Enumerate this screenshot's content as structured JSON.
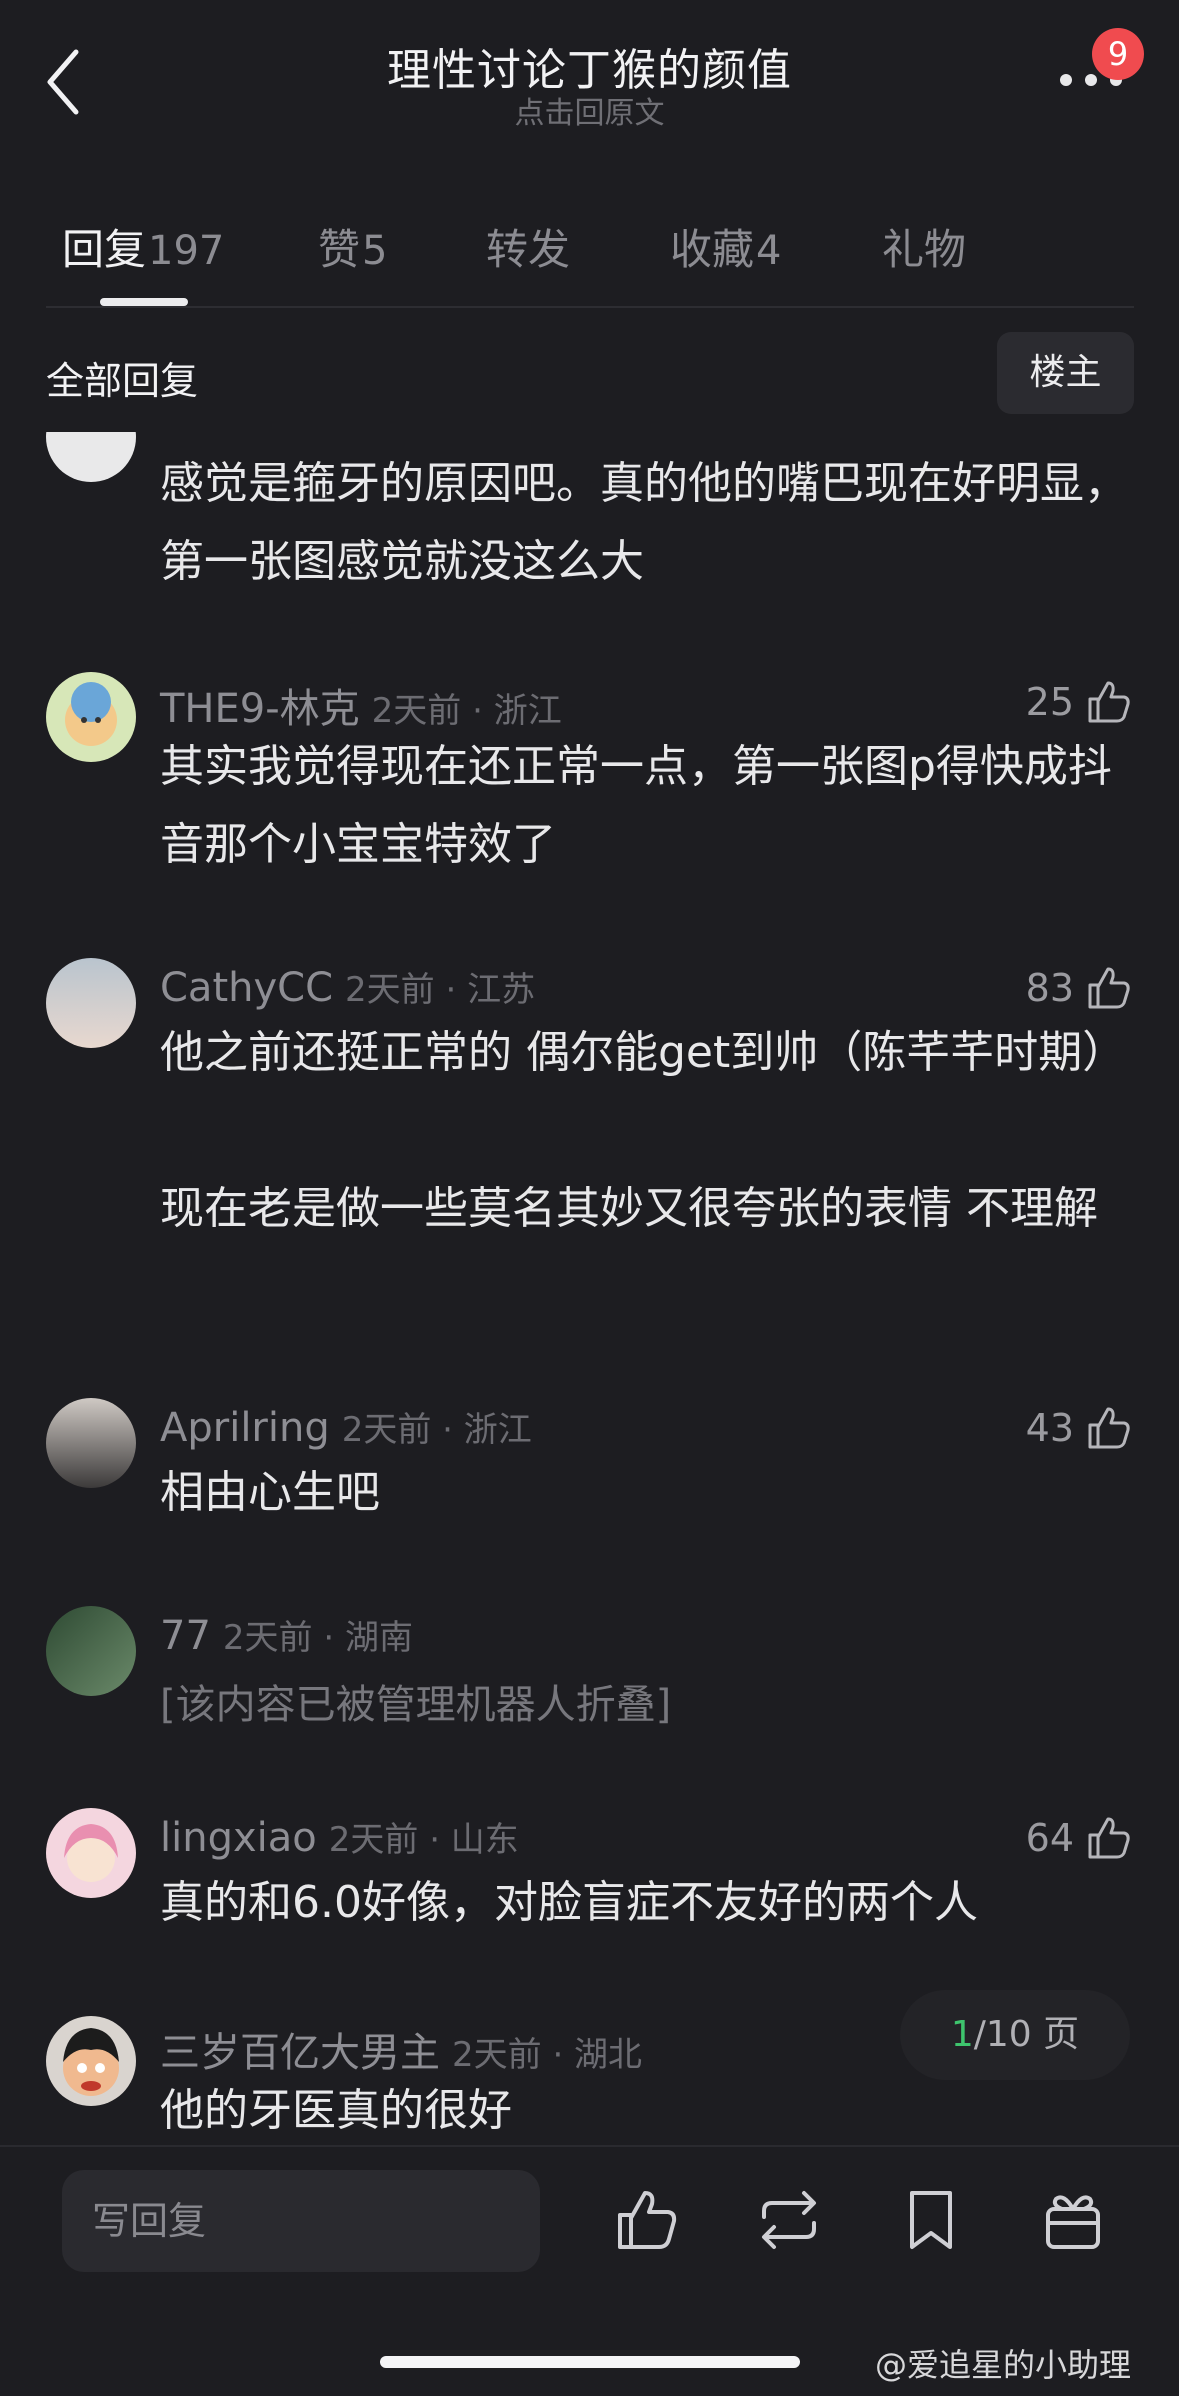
{
  "header": {
    "title": "理性讨论丁猴的颜值",
    "subtitle": "点击回原文",
    "badge_count": "9"
  },
  "tabs": [
    {
      "label": "回复",
      "count": "197"
    },
    {
      "label": "赞",
      "count": "5"
    },
    {
      "label": "转发",
      "count": ""
    },
    {
      "label": "收藏",
      "count": "4"
    },
    {
      "label": "礼物",
      "count": ""
    }
  ],
  "section": {
    "title": "全部回复",
    "owner_button": "楼主"
  },
  "comments": [
    {
      "name": "",
      "meta": "",
      "likes": "",
      "text": "感觉是箍牙的原因吧。真的他的嘴巴现在好明显，第一张图感觉就没这么大"
    },
    {
      "name": "THE9-林克",
      "meta": "2天前 · 浙江",
      "likes": "25",
      "text": "其实我觉得现在还正常一点，第一张图p得快成抖音那个小宝宝特效了"
    },
    {
      "name": "CathyCC",
      "meta": "2天前 · 江苏",
      "likes": "83",
      "text": "他之前还挺正常的 偶尔能get到帅（陈芊芊时期）",
      "text2": "现在老是做一些莫名其妙又很夸张的表情 不理解"
    },
    {
      "name": "Aprilring",
      "meta": "2天前 · 浙江",
      "likes": "43",
      "text": "相由心生吧"
    },
    {
      "name": "77",
      "meta": "2天前 · 湖南",
      "likes": "",
      "text": "[该内容已被管理机器人折叠]"
    },
    {
      "name": "lingxiao",
      "meta": "2天前 · 山东",
      "likes": "64",
      "text": "真的和6.0好像，对脸盲症不友好的两个人"
    },
    {
      "name": "三岁百亿大男主",
      "meta": "2天前 · 湖北",
      "likes": "",
      "text": "他的牙医真的很好"
    }
  ],
  "pager": {
    "current": "1",
    "total": "/10 页"
  },
  "bottom": {
    "reply_placeholder": "写回复"
  },
  "watermark": "@爱追星的小助理",
  "colors": {
    "background": "#1d1d21",
    "badge": "#f04b4f",
    "pager_current": "#3ec46d"
  }
}
